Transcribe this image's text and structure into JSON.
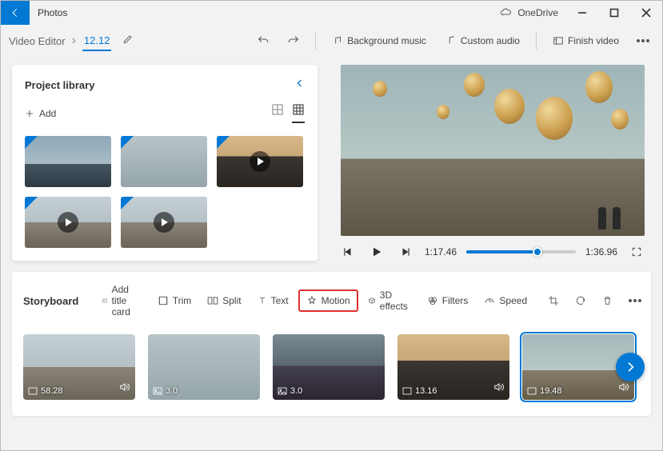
{
  "app": {
    "title": "Photos",
    "cloud_label": "OneDrive"
  },
  "breadcrumb": {
    "root": "Video Editor",
    "name": "12.12"
  },
  "toolbar": {
    "bg_music": "Background music",
    "custom_audio": "Custom audio",
    "finish": "Finish video"
  },
  "library": {
    "title": "Project library",
    "add_label": "Add"
  },
  "player": {
    "current_time": "1:17.46",
    "total_time": "1:36.96"
  },
  "storyboard": {
    "title": "Storyboard",
    "add_title_card": "Add title card",
    "trim": "Trim",
    "split": "Split",
    "text": "Text",
    "motion": "Motion",
    "effects3d": "3D effects",
    "filters": "Filters",
    "speed": "Speed",
    "clips": [
      {
        "duration": "58.28",
        "has_audio": true,
        "type": "video"
      },
      {
        "duration": "3.0",
        "has_audio": false,
        "type": "image"
      },
      {
        "duration": "3.0",
        "has_audio": false,
        "type": "image"
      },
      {
        "duration": "13.16",
        "has_audio": true,
        "type": "video"
      },
      {
        "duration": "19.48",
        "has_audio": true,
        "type": "video",
        "selected": true
      }
    ]
  }
}
